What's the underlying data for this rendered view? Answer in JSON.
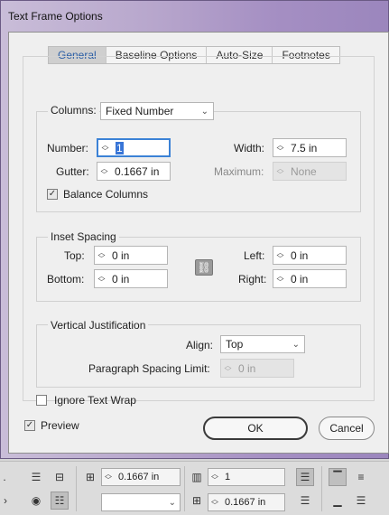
{
  "window": {
    "title": "Text Frame Options"
  },
  "tabs": [
    {
      "label": "General",
      "active": true
    },
    {
      "label": "Baseline Options",
      "active": false
    },
    {
      "label": "Auto-Size",
      "active": false
    },
    {
      "label": "Footnotes",
      "active": false
    }
  ],
  "columns": {
    "label": "Columns:",
    "type_value": "Fixed Number",
    "number_label": "Number:",
    "number_value": "1",
    "width_label": "Width:",
    "width_value": "7.5 in",
    "gutter_label": "Gutter:",
    "gutter_value": "0.1667 in",
    "maximum_label": "Maximum:",
    "maximum_value": "None",
    "balance_label": "Balance Columns",
    "balance_checked": true
  },
  "inset": {
    "title": "Inset Spacing",
    "top_label": "Top:",
    "top_value": "0 in",
    "bottom_label": "Bottom:",
    "bottom_value": "0 in",
    "left_label": "Left:",
    "left_value": "0 in",
    "right_label": "Right:",
    "right_value": "0 in"
  },
  "vertical": {
    "title": "Vertical Justification",
    "align_label": "Align:",
    "align_value": "Top",
    "spacing_label": "Paragraph Spacing Limit:",
    "spacing_value": "0 in"
  },
  "ignore_wrap": {
    "label": "Ignore Text Wrap",
    "checked": false
  },
  "preview": {
    "label": "Preview",
    "checked": true
  },
  "buttons": {
    "ok": "OK",
    "cancel": "Cancel"
  },
  "toolbar": {
    "gutter_value": "0.1667 in",
    "columns_value": "1",
    "gutter2_value": "0.1667 in"
  },
  "icons": {
    "arrows": "spinner-arrows-icon",
    "chevron": "chevron-down-icon",
    "check": "checkmark-icon",
    "chain": "link-icon"
  }
}
